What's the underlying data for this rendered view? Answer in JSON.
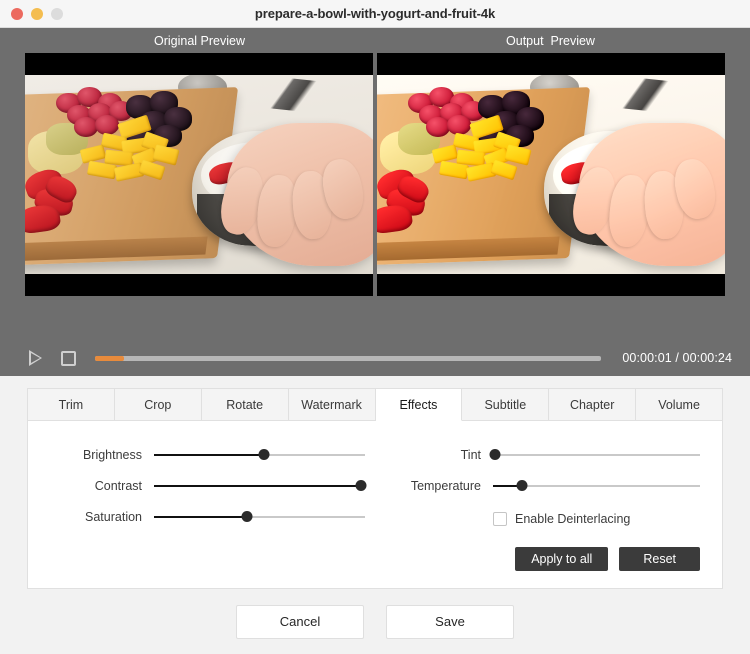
{
  "window": {
    "title": "prepare-a-bowl-with-yogurt-and-fruit-4k",
    "traffic_lights": [
      "close",
      "minimize",
      "zoom"
    ]
  },
  "preview": {
    "original_label": "Original Preview",
    "output_label": "Output  Preview"
  },
  "transport": {
    "play_icon": "play-icon",
    "stop_icon": "stop-icon",
    "progress_percent": 5.7,
    "timecode": "00:00:01 / 00:00:24",
    "current_time": "00:00:01",
    "total_time": "00:00:24",
    "progress_color": "#e88b3c"
  },
  "tabs": [
    {
      "label": "Trim",
      "active": false
    },
    {
      "label": "Crop",
      "active": false
    },
    {
      "label": "Rotate",
      "active": false
    },
    {
      "label": "Watermark",
      "active": false
    },
    {
      "label": "Effects",
      "active": true
    },
    {
      "label": "Subtitle",
      "active": false
    },
    {
      "label": "Chapter",
      "active": false
    },
    {
      "label": "Volume",
      "active": false
    }
  ],
  "effects": {
    "left_sliders": [
      {
        "label": "Brightness",
        "value": 52
      },
      {
        "label": "Contrast",
        "value": 98
      },
      {
        "label": "Saturation",
        "value": 44
      }
    ],
    "right_sliders": [
      {
        "label": "Tint",
        "value": 1
      },
      {
        "label": "Temperature",
        "value": 14
      }
    ],
    "deinterlacing": {
      "label": "Enable Deinterlacing",
      "checked": false
    },
    "apply_all_label": "Apply to all",
    "reset_label": "Reset"
  },
  "footer": {
    "cancel_label": "Cancel",
    "save_label": "Save"
  }
}
